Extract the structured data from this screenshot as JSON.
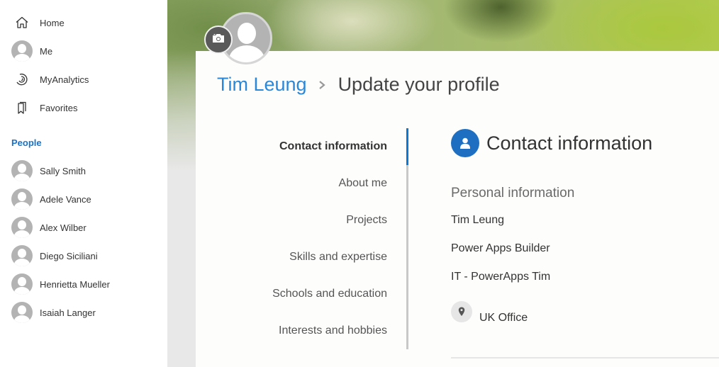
{
  "leftnav": {
    "items": [
      {
        "label": "Home",
        "icon": "home-icon"
      },
      {
        "label": "Me",
        "icon": "avatar"
      },
      {
        "label": "MyAnalytics",
        "icon": "analytics-icon"
      },
      {
        "label": "Favorites",
        "icon": "bookmark-icon"
      }
    ],
    "people_title": "People",
    "people": [
      {
        "name": "Sally Smith"
      },
      {
        "name": "Adele Vance"
      },
      {
        "name": "Alex Wilber"
      },
      {
        "name": "Diego Siciliani"
      },
      {
        "name": "Henrietta Mueller"
      },
      {
        "name": "Isaiah Langer"
      }
    ]
  },
  "header": {
    "breadcrumb_link": "Tim Leung",
    "breadcrumb_current": "Update your profile",
    "change_photo_icon": "camera-icon"
  },
  "section_nav": {
    "active_index": 0,
    "items": [
      "Contact information",
      "About me",
      "Projects",
      "Skills and expertise",
      "Schools and education",
      "Interests and hobbies"
    ]
  },
  "content": {
    "title": "Contact information",
    "title_icon": "person-icon",
    "subheading": "Personal information",
    "name": "Tim Leung",
    "job_title": "Power Apps Builder",
    "department": "IT - PowerApps Tim",
    "office_icon": "location-pin-icon",
    "office": "UK Office"
  },
  "colors": {
    "accent": "#0a78d4",
    "link": "#2b88d8",
    "people_title": "#1a73c8",
    "section_icon_bg": "#1e6fc2"
  }
}
